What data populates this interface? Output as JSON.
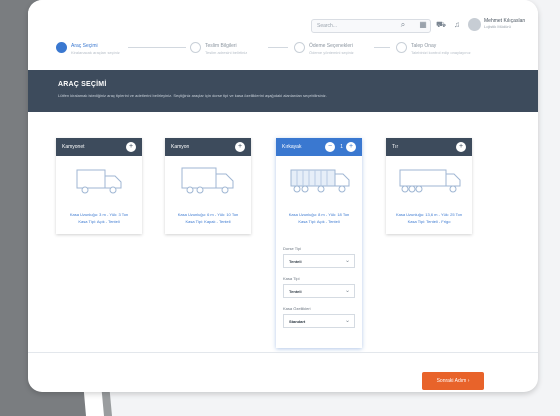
{
  "header": {
    "search_placeholder": "Search...",
    "user_name": "Mehmet Kılıçaslan",
    "user_role": "Lojistik Müdürü"
  },
  "steps": [
    {
      "title": "Araç Seçimi",
      "subtitle": "Kiralanacak araçları seçiniz",
      "active": true
    },
    {
      "title": "Teslim Bilgileri",
      "subtitle": "Teslim adresini belirtiniz",
      "active": false
    },
    {
      "title": "Ödeme Seçenekleri",
      "subtitle": "Ödeme yöntemini seçiniz",
      "active": false
    },
    {
      "title": "Talep Onay",
      "subtitle": "Talebinizi kontrol edip onaylayınız",
      "active": false
    }
  ],
  "banner": {
    "title": "ARAÇ SEÇİMİ",
    "description": "Lütfen kiralamak istediğiniz araç tiplerini ve adetlerini belirleyiniz. Seçtiğiniz araçlar için dorse tipi ve kasa özelliklerini aşağıdaki alanlardan seçebilirsiniz."
  },
  "vehicles": [
    {
      "name": "Kamyonet",
      "spec1": "Kasa Uzunluğu: 3 m - Yük: 3 Ton",
      "spec2": "Kasa Tipi: Açık - Tenteli",
      "count": "",
      "selected": false
    },
    {
      "name": "Kamyon",
      "spec1": "Kasa Uzunluğu: 6 m - Yük: 10 Ton",
      "spec2": "Kasa Tipi: Kapalı - Tenteli",
      "count": "",
      "selected": false
    },
    {
      "name": "Kırkayak",
      "spec1": "Kasa Uzunluğu: 8 m - Yük: 18 Ton",
      "spec2": "Kasa Tipi: Açık - Tenteli",
      "count": "1",
      "selected": true
    },
    {
      "name": "Tır",
      "spec1": "Kasa Uzunluğu: 13,6 m - Yük: 25 Ton",
      "spec2": "Kasa Tipi: Tenteli - Frigo",
      "count": "",
      "selected": false
    }
  ],
  "selected_options": [
    {
      "label": "Dorse Tipi",
      "value": "Tenteli"
    },
    {
      "label": "Kasa Tipi",
      "value": "Tenteli"
    },
    {
      "label": "Kasa Özellikleri",
      "value": "Standart"
    }
  ],
  "footer": {
    "next_label": "Sonraki Adım"
  },
  "icons": {
    "step_done": "check-icon",
    "add": "plus-icon",
    "remove": "minus-icon",
    "dropdown": "chevron-down-icon",
    "next": "chevron-right-icon"
  },
  "colors": {
    "accent": "#3a78d0",
    "header_dark": "#3d4b5c",
    "cta": "#e8632a"
  }
}
